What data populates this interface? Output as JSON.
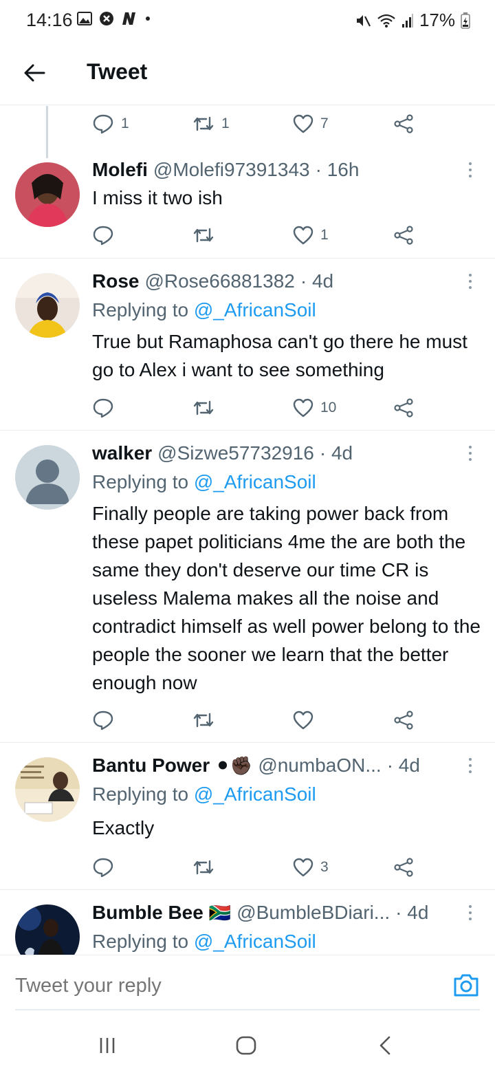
{
  "status_bar": {
    "time": "14:16",
    "battery": "17%",
    "icons_left": [
      "gallery-icon",
      "shield-icon",
      "n-app-icon",
      "dot-icon"
    ],
    "icons_right": [
      "mute-icon",
      "wifi-icon",
      "signal-icon",
      "battery-icon"
    ]
  },
  "header": {
    "title": "Tweet"
  },
  "top_actions": {
    "reply_count": "1",
    "retweet_count": "1",
    "like_count": "7"
  },
  "tweets": [
    {
      "name": "Molefi",
      "handle": "@Molefi97391343",
      "time": "· 16h",
      "replying_prefix": "",
      "replying_to": "",
      "text": "I miss it two ish",
      "reply_count": "",
      "retweet_count": "",
      "like_count": "1"
    },
    {
      "name": "Rose",
      "handle": "@Rose66881382",
      "time": "· 4d",
      "replying_prefix": "Replying to",
      "replying_to": "@_AfricanSoil",
      "text": "True but Ramaphosa can't go there he must go to Alex i want to see something",
      "reply_count": "",
      "retweet_count": "",
      "like_count": "10"
    },
    {
      "name": "walker",
      "handle": "@Sizwe57732916",
      "time": "· 4d",
      "replying_prefix": "Replying to",
      "replying_to": "@_AfricanSoil",
      "text": "Finally people are taking power back from these papet politicians 4me the are both the same they don't deserve our time CR is useless  Malema makes all the noise and contradict himself as well power belong to the people the sooner we learn that the better enough now",
      "reply_count": "",
      "retweet_count": "",
      "like_count": ""
    },
    {
      "name": "Bantu Power",
      "name_emoji": "⚫✊🏿",
      "handle": "@numbaON...",
      "time": "· 4d",
      "replying_prefix": "Replying to",
      "replying_to": "@_AfricanSoil",
      "text": "Exactly",
      "reply_count": "",
      "retweet_count": "",
      "like_count": "3"
    },
    {
      "name": "Bumble Bee",
      "name_emoji": "🇿🇦",
      "handle": "@BumbleBDiari...",
      "time": "· 4d",
      "replying_prefix": "Replying to",
      "replying_to": "@_AfricanSoil",
      "text": "",
      "reply_count": "",
      "retweet_count": "",
      "like_count": ""
    }
  ],
  "reply_box": {
    "placeholder": "Tweet your reply"
  },
  "colors": {
    "accent": "#1d9bf0",
    "secondary_text": "#536471",
    "divider": "#e6ecf0"
  }
}
